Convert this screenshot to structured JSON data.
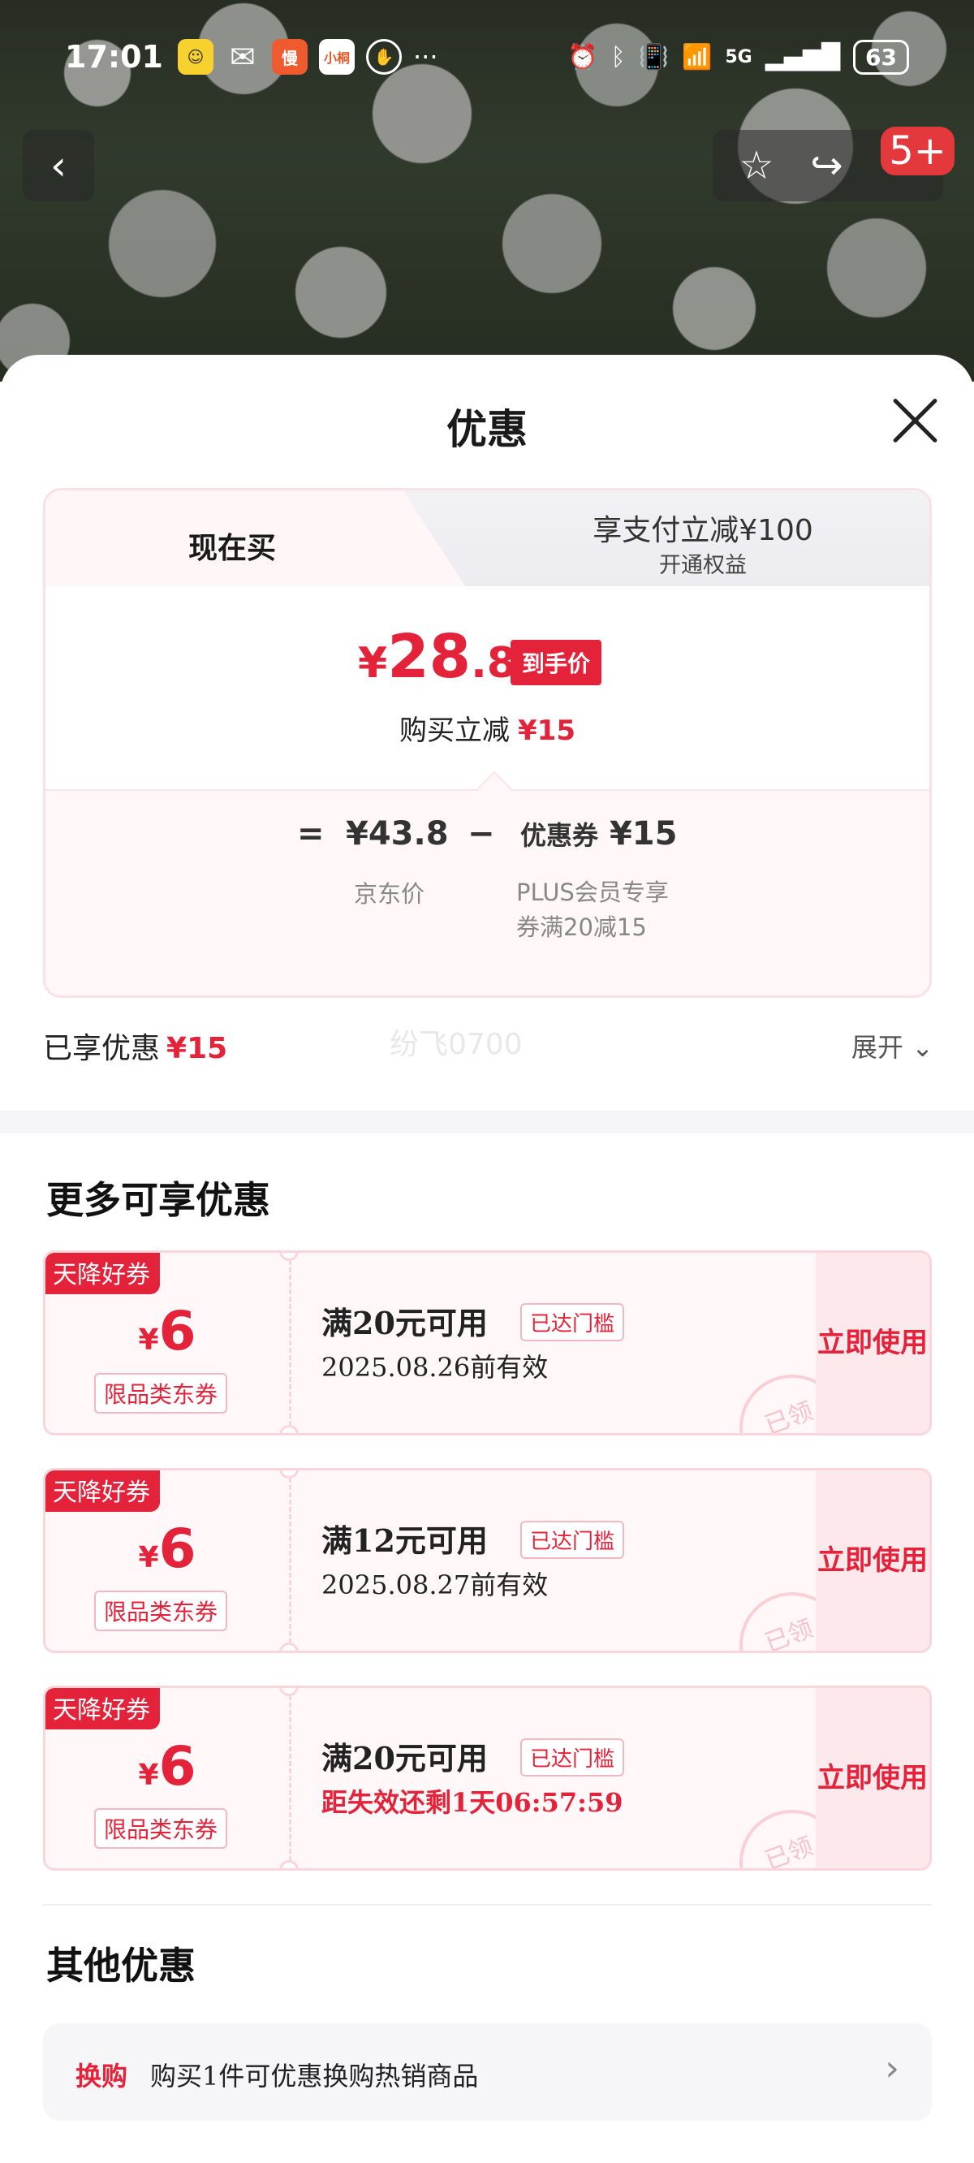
{
  "status_bar": {
    "time": "17:01",
    "app_icons": [
      "app-yellow-icon",
      "wechat-icon",
      "man-app-icon",
      "xiaohongshu-icon",
      "hand-icon"
    ],
    "app_icon_labels": [
      "",
      "",
      "慢",
      "小桐",
      ""
    ],
    "more": "···",
    "network": "5G",
    "battery": "63"
  },
  "nav": {
    "badge": "5+"
  },
  "sheet": {
    "title": "优惠"
  },
  "price_card": {
    "tab_now": "现在买",
    "tab_pay": "享支付立减¥100",
    "tab_pay_sub": "开通权益",
    "final_currency": "¥",
    "final_int": "28",
    "final_dec": ".8",
    "final_badge": "到手价",
    "reduce_label": "购买立减",
    "reduce_amount": "¥15",
    "eq": "=",
    "jd_price": "¥43.8",
    "minus": "−",
    "coupon_label": "优惠券",
    "coupon_amount": "¥15",
    "jd_price_label": "京东价",
    "coupon_desc": "PLUS会员专享券满20减15"
  },
  "enjoyed": {
    "label": "已享优惠",
    "amount": "¥15",
    "watermark": "纷飞0700",
    "expand": "展开"
  },
  "more_offers": {
    "title": "更多可享优惠",
    "coupons": [
      {
        "tag": "天降好券",
        "currency": "¥",
        "value": "6",
        "type": "限品类东券",
        "condition": "满20元可用",
        "reached": "已达门槛",
        "validity": "2025.08.26前有效",
        "action": "立即使用",
        "stamp": "已领"
      },
      {
        "tag": "天降好券",
        "currency": "¥",
        "value": "6",
        "type": "限品类东券",
        "condition": "满12元可用",
        "reached": "已达门槛",
        "validity": "2025.08.27前有效",
        "action": "立即使用",
        "stamp": "已领"
      },
      {
        "tag": "天降好券",
        "currency": "¥",
        "value": "6",
        "type": "限品类东券",
        "condition": "满20元可用",
        "reached": "已达门槛",
        "validity": "距失效还剩1天06:57:59",
        "action": "立即使用",
        "stamp": "已领"
      }
    ]
  },
  "other_offers": {
    "title": "其他优惠",
    "swap_tag": "换购",
    "swap_text": "购买1件可优惠换购热销商品"
  },
  "colors": {
    "accent": "#e4233a",
    "coupon_bg": "#fff7f8",
    "coupon_border": "#fbd5dc"
  }
}
